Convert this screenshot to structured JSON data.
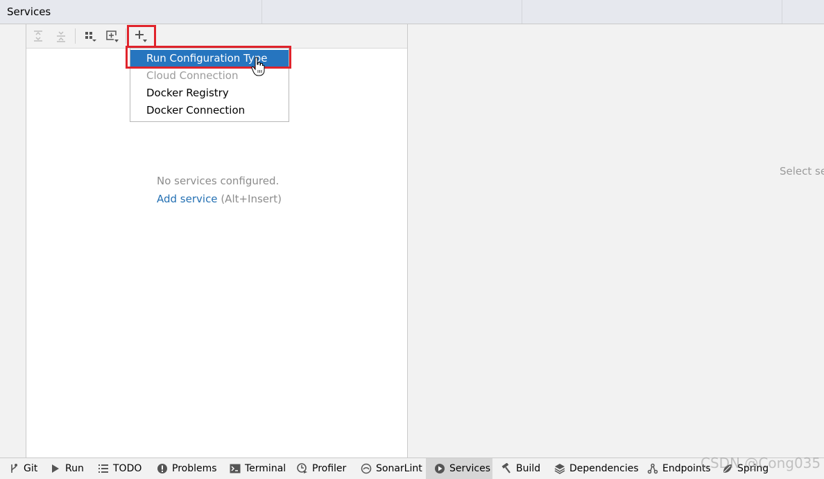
{
  "window": {
    "title": "Services"
  },
  "toolbar": {
    "buttons": [
      {
        "name": "expand-all",
        "icon": "expand-all-icon",
        "enabled": false
      },
      {
        "name": "collapse-all",
        "icon": "collapse-all-icon",
        "enabled": false
      },
      {
        "name": "group-by",
        "icon": "group-by-icon",
        "enabled": true
      },
      {
        "name": "new-tab",
        "icon": "new-tab-icon",
        "enabled": true
      },
      {
        "name": "add",
        "icon": "plus-icon",
        "enabled": true
      }
    ]
  },
  "dropdown": {
    "items": [
      {
        "label": "Run Configuration Type",
        "state": "selected"
      },
      {
        "label": "Cloud Connection",
        "state": "disabled"
      },
      {
        "label": "Docker Registry",
        "state": "normal"
      },
      {
        "label": "Docker Connection",
        "state": "normal"
      }
    ]
  },
  "empty_state": {
    "message": "No services configured.",
    "link": "Add service",
    "shortcut": "(Alt+Insert)"
  },
  "right_panel": {
    "hint": "Select se"
  },
  "bottom_tabs": [
    {
      "label": "Git",
      "icon": "git-branch-icon"
    },
    {
      "label": "Run",
      "icon": "run-icon"
    },
    {
      "label": "TODO",
      "icon": "todo-list-icon"
    },
    {
      "label": "Problems",
      "icon": "problems-icon"
    },
    {
      "label": "Terminal",
      "icon": "terminal-icon"
    },
    {
      "label": "Profiler",
      "icon": "profiler-icon"
    },
    {
      "label": "SonarLint",
      "icon": "sonarlint-icon"
    },
    {
      "label": "Services",
      "icon": "services-icon",
      "active": true
    },
    {
      "label": "Build",
      "icon": "build-hammer-icon"
    },
    {
      "label": "Dependencies",
      "icon": "dependencies-icon"
    },
    {
      "label": "Endpoints",
      "icon": "endpoints-icon"
    },
    {
      "label": "Spring",
      "icon": "spring-icon"
    }
  ],
  "watermark": "CSDN @Cong035",
  "colors": {
    "selection": "#2675bf",
    "link": "#2470b3",
    "highlight_box": "#e0232b"
  }
}
